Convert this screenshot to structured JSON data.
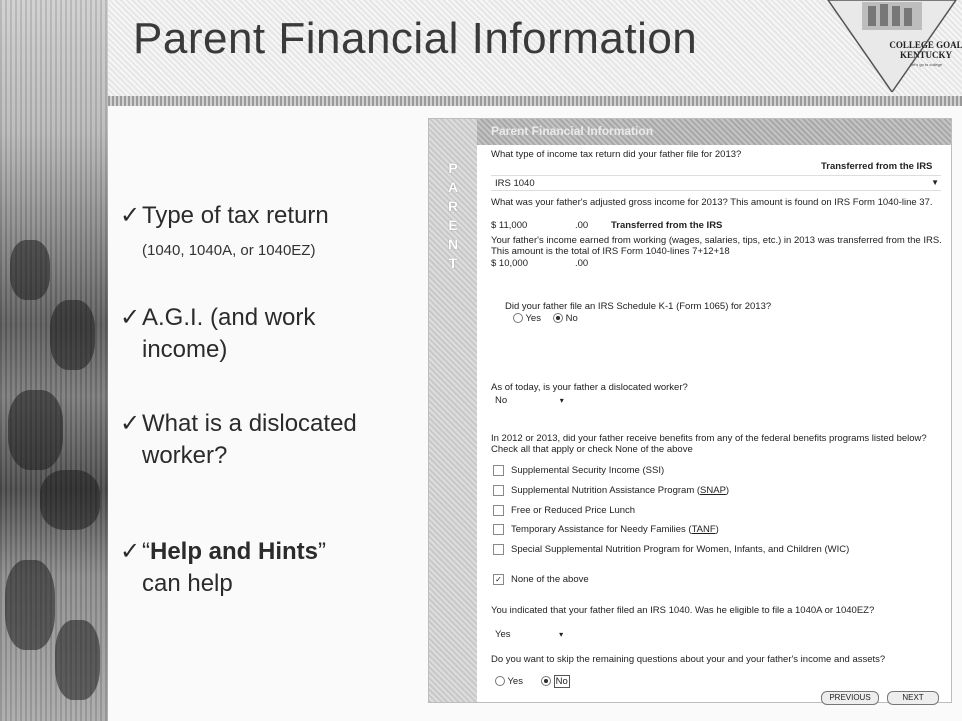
{
  "slide": {
    "title": "Parent Financial Information",
    "logo": {
      "line1": "COLLEGE GOAL",
      "line2": "KENTUCKY",
      "tagline": "Let's go to college"
    }
  },
  "bullets": [
    {
      "check": "✓",
      "text": "Type of tax return",
      "sub": "(1040, 1040A, or 1040EZ)"
    },
    {
      "check": "✓",
      "text": "A.G.I. (and work",
      "text2": "income)"
    },
    {
      "check": "✓",
      "text": "What is a dislocated",
      "text2": "worker?"
    },
    {
      "check": "✓",
      "text_open": "“",
      "text_bold": "Help and Hints",
      "text_close": "”",
      "text2": "can help"
    }
  ],
  "panel": {
    "header": "Parent Financial Information",
    "side_letters": [
      "P",
      "A",
      "R",
      "E",
      "N",
      "T"
    ],
    "q_tax_type": "What type of income tax return did your father file for 2013?",
    "transferred_label": "Transferred from the IRS",
    "tax_type_value": "IRS 1040",
    "q_agi": "What was your father's adjusted gross income for 2013? This amount is found on IRS Form 1040-line 37.",
    "agi_value": "$ 11,000",
    "agi_cents": ".00",
    "agi_transferred": "Transferred from the IRS",
    "q_work": "Your father's income earned from working (wages, salaries, tips, etc.) in 2013 was transferred from the IRS. This amount is the total of IRS Form 1040-lines 7+12+18",
    "work_value": "$ 10,000",
    "work_cents": ".00",
    "q_k1": "Did your father file an IRS Schedule K-1 (Form 1065) for 2013?",
    "k1_yes": "Yes",
    "k1_no": "No",
    "q_dislocated": "As of today, is your father a dislocated worker?",
    "dislocated_value": "No",
    "q_benefits": "In 2012 or 2013, did your father receive benefits from any of the federal benefits programs listed below? Check all that apply or check None of the above",
    "benefits": [
      {
        "label": "Supplemental Security Income (SSI)",
        "checked": false
      },
      {
        "label_pre": "Supplemental Nutrition Assistance Program (",
        "label_link": "SNAP",
        "label_post": ")",
        "checked": false
      },
      {
        "label": "Free or Reduced Price Lunch",
        "checked": false
      },
      {
        "label_pre": "Temporary Assistance for Needy Families (",
        "label_link": "TANF",
        "label_post": ")",
        "checked": false
      },
      {
        "label": "Special Supplemental Nutrition Program for Women, Infants, and Children (WIC)",
        "checked": false
      },
      {
        "label": "None of the above",
        "checked": true
      }
    ],
    "q_1040a": "You indicated that your father filed an IRS 1040. Was he eligible to file a 1040A or 1040EZ?",
    "eligible_value": "Yes",
    "q_skip": "Do you want to skip the remaining questions about your and your father's income and assets?",
    "skip_yes": "Yes",
    "skip_no": "No",
    "previous_button": "PREVIOUS",
    "next_button": "NEXT"
  }
}
